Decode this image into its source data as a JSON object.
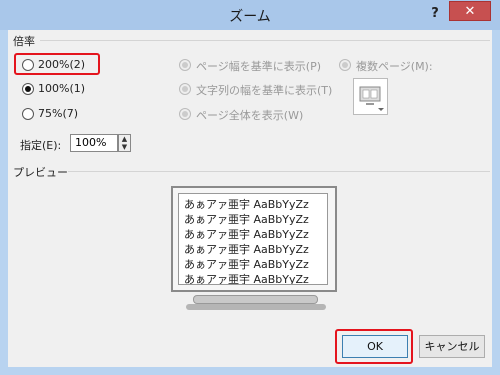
{
  "window": {
    "title": "ズーム",
    "help_glyph": "?",
    "close_glyph": "✕"
  },
  "zoom_group": {
    "label": "倍率",
    "options": [
      {
        "label": "200%(2)",
        "selected": false
      },
      {
        "label": "100%(1)",
        "selected": true
      },
      {
        "label": "75%(7)",
        "selected": false
      }
    ],
    "page_options": [
      "ページ幅を基準に表示(P)",
      "文字列の幅を基準に表示(T)",
      "ページ全体を表示(W)"
    ],
    "multipage_label": "複数ページ(M):",
    "custom_label": "指定(E):",
    "custom_value": "100%"
  },
  "preview": {
    "label": "プレビュー",
    "lines": [
      "あぁアァ亜宇 AaBbYyZz",
      "あぁアァ亜宇 AaBbYyZz",
      "あぁアァ亜宇 AaBbYyZz",
      "あぁアァ亜宇 AaBbYyZz",
      "あぁアァ亜宇 AaBbYyZz",
      "あぁアァ亜宇 AaBbYyZz"
    ]
  },
  "buttons": {
    "ok": "OK",
    "cancel": "キャンセル"
  },
  "colors": {
    "highlight": "#e4141d",
    "title_bar": "#a9c7ea",
    "close": "#c75050"
  }
}
